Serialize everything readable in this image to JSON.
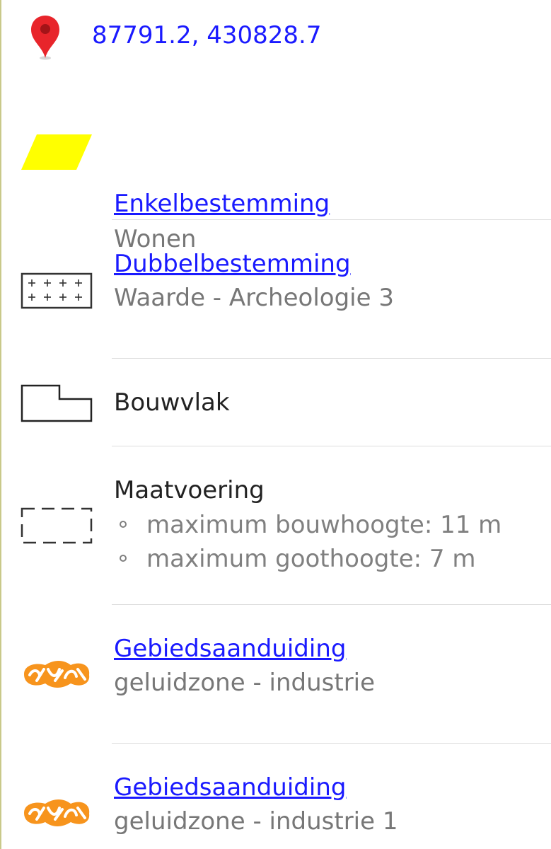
{
  "location": {
    "coordinates": "87791.2, 430828.7",
    "icon": "map-pin-icon",
    "pin_color": "#e8252b"
  },
  "items": [
    {
      "title": "Enkelbestemming",
      "subtitle": "Wonen",
      "icon": "yellow-parallelogram-icon",
      "icon_color": "#ffff00",
      "is_link": true
    },
    {
      "title": "Dubbelbestemming",
      "subtitle": "Waarde - Archeologie 3",
      "icon": "plus-grid-icon",
      "is_link": true
    },
    {
      "title": "Bouwvlak",
      "icon": "building-outline-icon",
      "is_link": false
    },
    {
      "title": "Maatvoering",
      "icon": "dashed-rectangle-icon",
      "is_link": false,
      "details": [
        "maximum bouwhoogte: 11 m",
        "maximum goothoogte: 7 m"
      ]
    },
    {
      "title": "Gebiedsaanduiding",
      "subtitle": "geluidzone - industrie",
      "icon": "orange-pattern-icon",
      "icon_color": "#f7941d",
      "is_link": true
    },
    {
      "title": "Gebiedsaanduiding",
      "subtitle": "geluidzone - industrie 1",
      "icon": "orange-pattern-icon",
      "icon_color": "#f7941d",
      "is_link": true
    }
  ],
  "colors": {
    "link": "#1a1aff",
    "subtitle": "#777777",
    "divider": "#dddddd"
  }
}
